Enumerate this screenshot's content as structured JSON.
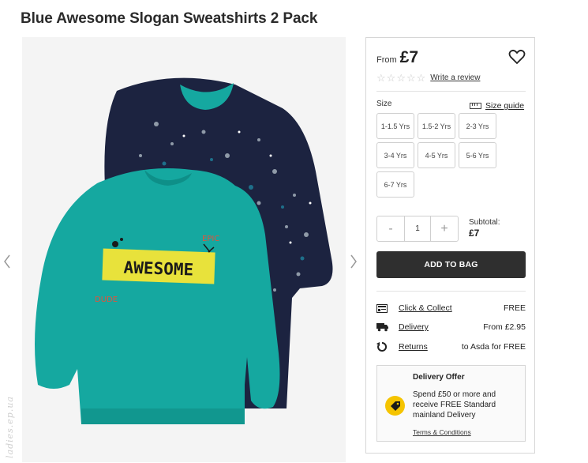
{
  "product": {
    "title": "Blue Awesome Slogan Sweatshirts 2 Pack"
  },
  "gallery": {
    "image_name": "sweatshirts-2-pack",
    "prev_icon": "chevron-left-icon",
    "next_icon": "chevron-right-icon",
    "watermark": "ladies.ep.ua",
    "print_main": "AWESOME",
    "print_small_top": "EPIC",
    "print_small_bottom": "DUDE",
    "colors": {
      "teal": "#15a8a0",
      "navy": "#1c2340",
      "yellow": "#e8e23b"
    }
  },
  "pricing": {
    "prefix": "From",
    "price": "£7"
  },
  "rating": {
    "stars": 0,
    "max": 5,
    "review_link": "Write a review"
  },
  "sizes": {
    "label": "Size",
    "guide_label": "Size guide",
    "options": [
      "1-1.5 Yrs",
      "1.5-2 Yrs",
      "2-3 Yrs",
      "3-4 Yrs",
      "4-5 Yrs",
      "5-6 Yrs",
      "6-7 Yrs"
    ]
  },
  "quantity": {
    "minus": "-",
    "value": "1",
    "plus": "+"
  },
  "subtotal": {
    "label": "Subtotal:",
    "value": "£7"
  },
  "cart": {
    "add_label": "ADD TO BAG",
    "button_color": "#2f2f2f"
  },
  "delivery": [
    {
      "icon": "store-icon",
      "label": "Click & Collect",
      "value": "FREE"
    },
    {
      "icon": "truck-icon",
      "label": "Delivery",
      "value": "From £2.95"
    },
    {
      "icon": "returns-icon",
      "label": "Returns",
      "value": "to Asda for FREE"
    }
  ],
  "offer": {
    "title": "Delivery Offer",
    "text": "Spend £50 or more and receive FREE Standard mainland Delivery",
    "link": "Terms & Conditions",
    "icon": "tag-icon",
    "icon_color": "#f5c400"
  }
}
